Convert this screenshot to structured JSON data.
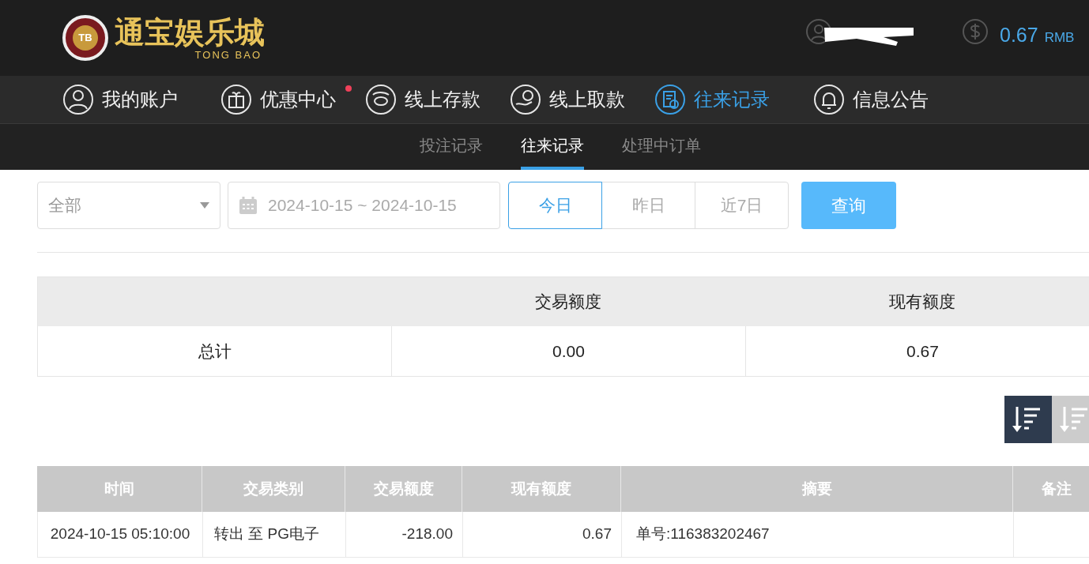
{
  "header": {
    "logo": {
      "badge": "TB",
      "name": "通宝娱乐城",
      "subtitle": "TONG BAO"
    },
    "balance": {
      "amount": "0.67",
      "currency": "RMB"
    }
  },
  "nav": [
    {
      "label": "我的账户",
      "selected": false,
      "dot": false
    },
    {
      "label": "优惠中心",
      "selected": false,
      "dot": true
    },
    {
      "label": "线上存款",
      "selected": false,
      "dot": false
    },
    {
      "label": "线上取款",
      "selected": false,
      "dot": false
    },
    {
      "label": "往来记录",
      "selected": true,
      "dot": false
    },
    {
      "label": "信息公告",
      "selected": false,
      "dot": false
    }
  ],
  "subnav": [
    {
      "label": "投注记录",
      "selected": false
    },
    {
      "label": "往来记录",
      "selected": true
    },
    {
      "label": "处理中订单",
      "selected": false
    }
  ],
  "filters": {
    "type_select": "全部",
    "date_range": "2024-10-15 ~ 2024-10-15",
    "quick_ranges": [
      {
        "label": "今日",
        "selected": true
      },
      {
        "label": "昨日",
        "selected": false
      },
      {
        "label": "近7日",
        "selected": false
      }
    ],
    "query_button": "查询"
  },
  "summary": {
    "columns": [
      "交易额度",
      "现有额度"
    ],
    "row": {
      "label": "总计",
      "values": [
        "0.00",
        "0.67"
      ]
    }
  },
  "sort_buttons": [
    {
      "selected": true
    },
    {
      "selected": false
    }
  ],
  "records": {
    "columns": [
      "时间",
      "交易类别",
      "交易额度",
      "现有额度",
      "摘要",
      "备注"
    ],
    "rows": [
      [
        "2024-10-15 05:10:00",
        "转出 至 PG电子",
        "-218.00",
        "0.67",
        "单号:116383202467"
      ]
    ]
  }
}
